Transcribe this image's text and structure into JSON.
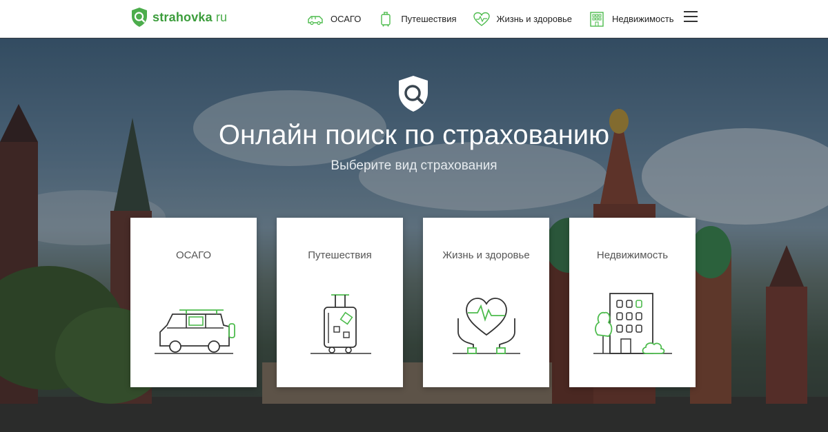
{
  "header": {
    "logo": {
      "name": "strahovka",
      "tld": "ru"
    },
    "nav": [
      {
        "label": "ОСАГО",
        "icon": "car-icon"
      },
      {
        "label": "Путешествия",
        "icon": "suitcase-icon"
      },
      {
        "label": "Жизнь и здоровье",
        "icon": "heart-icon"
      },
      {
        "label": "Недвижимость",
        "icon": "building-icon"
      }
    ],
    "menu_icon": "hamburger-menu-icon"
  },
  "hero": {
    "icon": "shield-search-icon",
    "title": "Онлайн поиск по страхованию",
    "subtitle": "Выберите вид страхования"
  },
  "cards": [
    {
      "label": "ОСАГО",
      "icon": "car-illustration"
    },
    {
      "label": "Путешествия",
      "icon": "suitcase-illustration"
    },
    {
      "label": "Жизнь и здоровье",
      "icon": "heart-hands-illustration"
    },
    {
      "label": "Недвижимость",
      "icon": "building-illustration"
    }
  ],
  "colors": {
    "accent": "#4cbb4c",
    "line": "#333333",
    "header_bg": "#ffffff"
  }
}
